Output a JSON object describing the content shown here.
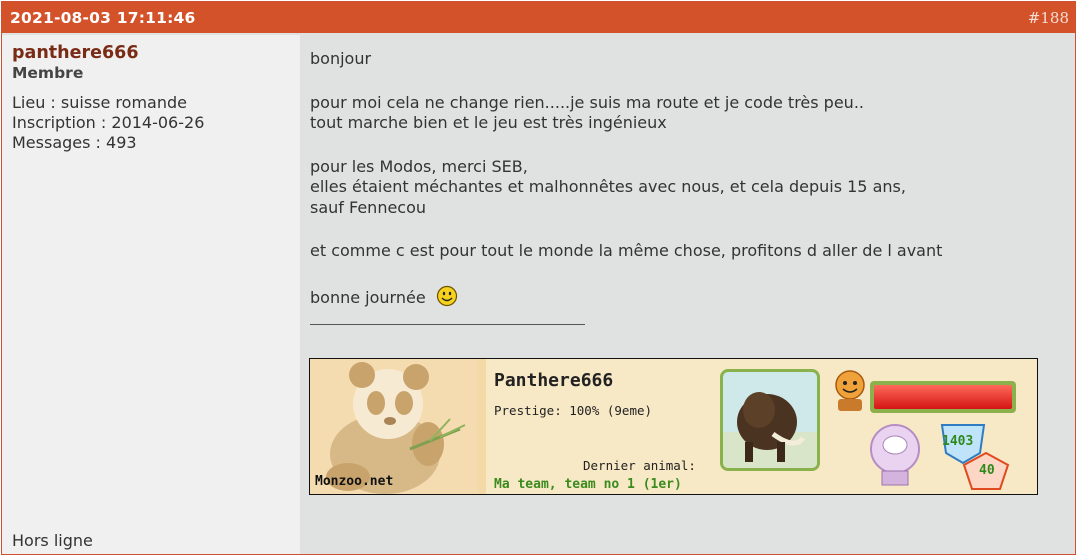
{
  "post": {
    "date": "2021-08-03 17:11:46",
    "number": "#188"
  },
  "author": {
    "name": "panthere666",
    "rank": "Membre",
    "location": "Lieu : suisse romande",
    "registration": "Inscription : 2014-06-26",
    "messages": "Messages : 493",
    "status": "Hors ligne"
  },
  "message": {
    "p1": "bonjour",
    "p2_l1": "pour moi cela ne change rien.....je suis ma route et je code très peu..",
    "p2_l2": "tout marche bien et le jeu est très ingénieux",
    "p3_l1": "pour les Modos, merci SEB,",
    "p3_l2": "elles étaient méchantes et malhonnêtes avec nous, et cela depuis 15 ans,",
    "p3_l3": "sauf Fennecou",
    "p4": "et comme c est pour tout le monde la même chose, profitons d aller de l avant",
    "p5": "bonne journée",
    "smiley_icon": "smiley-icon"
  },
  "signature": {
    "site": "Monzoo.net",
    "player": "Panthere666",
    "prestige": "Prestige: 100% (9eme)",
    "last_animal_label": "Dernier animal:",
    "team": "Ma team, team no 1 (1er)",
    "stat_a": "1403",
    "stat_b": "40",
    "progress": 1.0
  },
  "colors": {
    "header_bg": "#d4522a",
    "author_name": "#7a2b15",
    "team_green": "#3b8b1f"
  }
}
